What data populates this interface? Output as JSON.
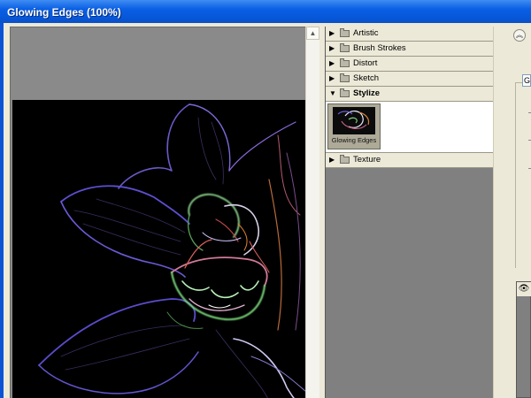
{
  "window": {
    "title": "Glowing Edges (100%)"
  },
  "gallery": {
    "categories": [
      {
        "label": "Artistic",
        "expanded": false
      },
      {
        "label": "Brush Strokes",
        "expanded": false
      },
      {
        "label": "Distort",
        "expanded": false
      },
      {
        "label": "Sketch",
        "expanded": false
      },
      {
        "label": "Stylize",
        "expanded": true
      },
      {
        "label": "Texture",
        "expanded": false
      }
    ],
    "selected_filter": {
      "label": "Glowing Edges"
    }
  },
  "settings": {
    "field_value": "G"
  },
  "icons": {
    "collapse": "double-chevron-up-icon",
    "eye": "eye-icon",
    "collapsed_arrow": "triangle-right-icon",
    "expanded_arrow": "triangle-down-icon"
  },
  "colors": {
    "titlebar": "#0a5fe4",
    "panel_bg": "#ece9d8",
    "preview_bg": "#8a8a8a",
    "canvas_bg": "#000000"
  }
}
